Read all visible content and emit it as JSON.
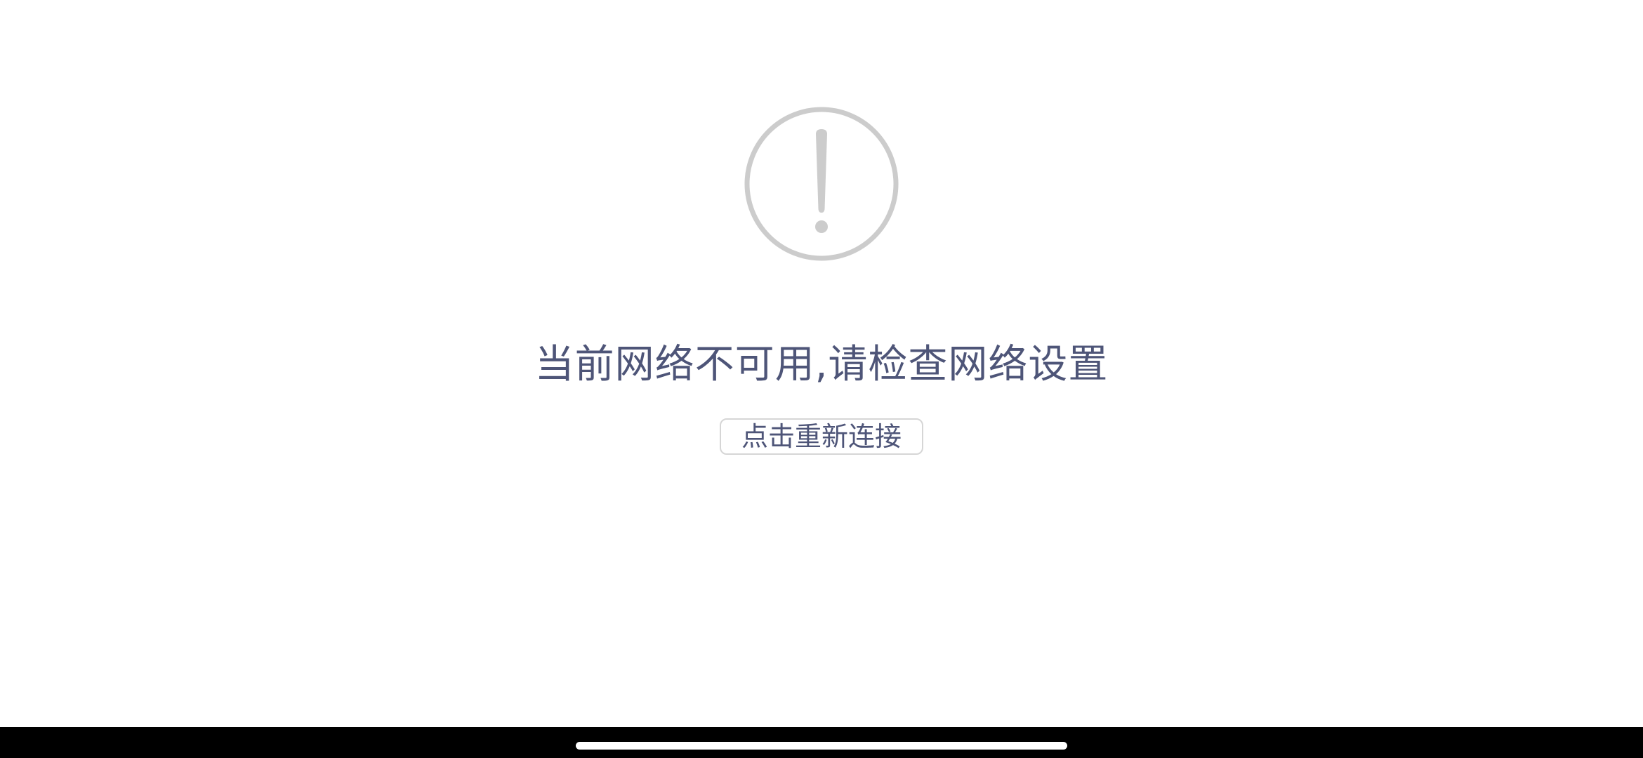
{
  "error_view": {
    "icon": "exclamation-circle-icon",
    "icon_color": "#cccccc",
    "message": "当前网络不可用,请检查网络设置",
    "message_color": "#4e5578",
    "reconnect_label": "点击重新连接",
    "button_border_color": "#d6d6d6"
  },
  "system_nav": {
    "background_color": "#000000",
    "indicator": "home-indicator"
  }
}
